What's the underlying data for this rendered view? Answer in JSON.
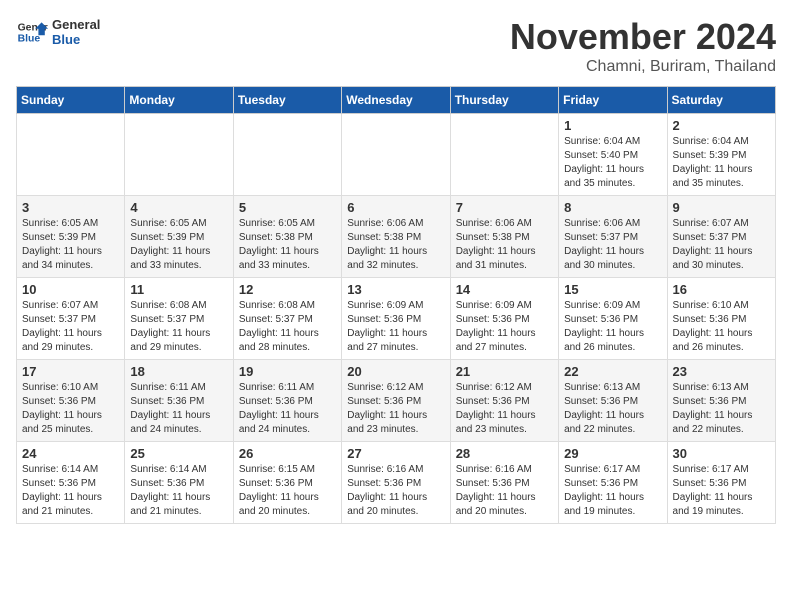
{
  "logo": {
    "line1": "General",
    "line2": "Blue"
  },
  "title": "November 2024",
  "location": "Chamni, Buriram, Thailand",
  "weekdays": [
    "Sunday",
    "Monday",
    "Tuesday",
    "Wednesday",
    "Thursday",
    "Friday",
    "Saturday"
  ],
  "weeks": [
    [
      {
        "day": "",
        "info": ""
      },
      {
        "day": "",
        "info": ""
      },
      {
        "day": "",
        "info": ""
      },
      {
        "day": "",
        "info": ""
      },
      {
        "day": "",
        "info": ""
      },
      {
        "day": "1",
        "info": "Sunrise: 6:04 AM\nSunset: 5:40 PM\nDaylight: 11 hours\nand 35 minutes."
      },
      {
        "day": "2",
        "info": "Sunrise: 6:04 AM\nSunset: 5:39 PM\nDaylight: 11 hours\nand 35 minutes."
      }
    ],
    [
      {
        "day": "3",
        "info": "Sunrise: 6:05 AM\nSunset: 5:39 PM\nDaylight: 11 hours\nand 34 minutes."
      },
      {
        "day": "4",
        "info": "Sunrise: 6:05 AM\nSunset: 5:39 PM\nDaylight: 11 hours\nand 33 minutes."
      },
      {
        "day": "5",
        "info": "Sunrise: 6:05 AM\nSunset: 5:38 PM\nDaylight: 11 hours\nand 33 minutes."
      },
      {
        "day": "6",
        "info": "Sunrise: 6:06 AM\nSunset: 5:38 PM\nDaylight: 11 hours\nand 32 minutes."
      },
      {
        "day": "7",
        "info": "Sunrise: 6:06 AM\nSunset: 5:38 PM\nDaylight: 11 hours\nand 31 minutes."
      },
      {
        "day": "8",
        "info": "Sunrise: 6:06 AM\nSunset: 5:37 PM\nDaylight: 11 hours\nand 30 minutes."
      },
      {
        "day": "9",
        "info": "Sunrise: 6:07 AM\nSunset: 5:37 PM\nDaylight: 11 hours\nand 30 minutes."
      }
    ],
    [
      {
        "day": "10",
        "info": "Sunrise: 6:07 AM\nSunset: 5:37 PM\nDaylight: 11 hours\nand 29 minutes."
      },
      {
        "day": "11",
        "info": "Sunrise: 6:08 AM\nSunset: 5:37 PM\nDaylight: 11 hours\nand 29 minutes."
      },
      {
        "day": "12",
        "info": "Sunrise: 6:08 AM\nSunset: 5:37 PM\nDaylight: 11 hours\nand 28 minutes."
      },
      {
        "day": "13",
        "info": "Sunrise: 6:09 AM\nSunset: 5:36 PM\nDaylight: 11 hours\nand 27 minutes."
      },
      {
        "day": "14",
        "info": "Sunrise: 6:09 AM\nSunset: 5:36 PM\nDaylight: 11 hours\nand 27 minutes."
      },
      {
        "day": "15",
        "info": "Sunrise: 6:09 AM\nSunset: 5:36 PM\nDaylight: 11 hours\nand 26 minutes."
      },
      {
        "day": "16",
        "info": "Sunrise: 6:10 AM\nSunset: 5:36 PM\nDaylight: 11 hours\nand 26 minutes."
      }
    ],
    [
      {
        "day": "17",
        "info": "Sunrise: 6:10 AM\nSunset: 5:36 PM\nDaylight: 11 hours\nand 25 minutes."
      },
      {
        "day": "18",
        "info": "Sunrise: 6:11 AM\nSunset: 5:36 PM\nDaylight: 11 hours\nand 24 minutes."
      },
      {
        "day": "19",
        "info": "Sunrise: 6:11 AM\nSunset: 5:36 PM\nDaylight: 11 hours\nand 24 minutes."
      },
      {
        "day": "20",
        "info": "Sunrise: 6:12 AM\nSunset: 5:36 PM\nDaylight: 11 hours\nand 23 minutes."
      },
      {
        "day": "21",
        "info": "Sunrise: 6:12 AM\nSunset: 5:36 PM\nDaylight: 11 hours\nand 23 minutes."
      },
      {
        "day": "22",
        "info": "Sunrise: 6:13 AM\nSunset: 5:36 PM\nDaylight: 11 hours\nand 22 minutes."
      },
      {
        "day": "23",
        "info": "Sunrise: 6:13 AM\nSunset: 5:36 PM\nDaylight: 11 hours\nand 22 minutes."
      }
    ],
    [
      {
        "day": "24",
        "info": "Sunrise: 6:14 AM\nSunset: 5:36 PM\nDaylight: 11 hours\nand 21 minutes."
      },
      {
        "day": "25",
        "info": "Sunrise: 6:14 AM\nSunset: 5:36 PM\nDaylight: 11 hours\nand 21 minutes."
      },
      {
        "day": "26",
        "info": "Sunrise: 6:15 AM\nSunset: 5:36 PM\nDaylight: 11 hours\nand 20 minutes."
      },
      {
        "day": "27",
        "info": "Sunrise: 6:16 AM\nSunset: 5:36 PM\nDaylight: 11 hours\nand 20 minutes."
      },
      {
        "day": "28",
        "info": "Sunrise: 6:16 AM\nSunset: 5:36 PM\nDaylight: 11 hours\nand 20 minutes."
      },
      {
        "day": "29",
        "info": "Sunrise: 6:17 AM\nSunset: 5:36 PM\nDaylight: 11 hours\nand 19 minutes."
      },
      {
        "day": "30",
        "info": "Sunrise: 6:17 AM\nSunset: 5:36 PM\nDaylight: 11 hours\nand 19 minutes."
      }
    ]
  ]
}
